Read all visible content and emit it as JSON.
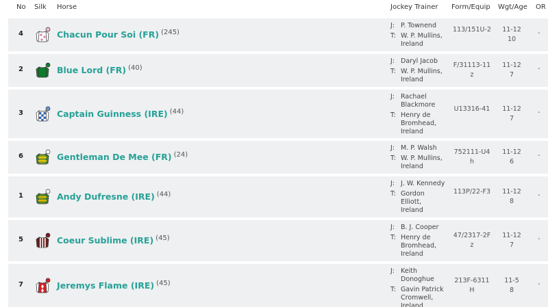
{
  "headers": {
    "no": "No",
    "silk": "Silk",
    "horse": "Horse",
    "jockey_trainer": "Jockey Trainer",
    "form": "Form/Equip",
    "wgt": "Wgt/Age",
    "or": "OR"
  },
  "runners": [
    {
      "no": "4",
      "horse": "Chacun Pour Soi (FR)",
      "rating": "(245)",
      "jockey_prefix": "J:",
      "jockey": [
        "P. Townend"
      ],
      "trainer_prefix": "T:",
      "trainer": [
        "W. P. Mullins,",
        "Ireland"
      ],
      "form": "113/151U-2",
      "equip": "",
      "wgt": "11-12",
      "age": "10",
      "or": "-",
      "silk": {
        "body": "#ffffff",
        "sleeves": "#ffffff",
        "pattern": "#d97aa6",
        "cap": "#f3b8cf"
      }
    },
    {
      "no": "2",
      "horse": "Blue Lord (FR)",
      "rating": "(40)",
      "jockey_prefix": "J:",
      "jockey": [
        "Daryl Jacob"
      ],
      "trainer_prefix": "T:",
      "trainer": [
        "W. P. Mullins,",
        "Ireland"
      ],
      "form": "F/31113-11",
      "equip": "z",
      "wgt": "11-12",
      "age": "7",
      "or": "-",
      "silk": {
        "body": "#0f7a2f",
        "sleeves": "#0f7a2f",
        "pattern": "#111111",
        "cap": "#0f7a2f"
      }
    },
    {
      "no": "3",
      "horse": "Captain Guinness (IRE)",
      "rating": "(44)",
      "jockey_prefix": "J:",
      "jockey": [
        "Rachael",
        "Blackmore"
      ],
      "trainer_prefix": "T:",
      "trainer": [
        "Henry de",
        "Bromhead,",
        "Ireland"
      ],
      "form": "U13316-41",
      "equip": "",
      "wgt": "11-12",
      "age": "7",
      "or": "-",
      "silk": {
        "body": "#ffffff",
        "sleeves": "#ffffff",
        "pattern": "#2f5fa8",
        "cap": "#6f93c9"
      }
    },
    {
      "no": "6",
      "horse": "Gentleman De Mee (FR)",
      "rating": "(24)",
      "jockey_prefix": "J:",
      "jockey": [
        "M. P. Walsh"
      ],
      "trainer_prefix": "T:",
      "trainer": [
        "W. P. Mullins,",
        "Ireland"
      ],
      "form": "752111-U4",
      "equip": "h",
      "wgt": "11-12",
      "age": "6",
      "or": "-",
      "silk": {
        "body": "#7a9a2a",
        "sleeves": "#2e8b2e",
        "pattern": "#e8c200",
        "cap": "#ffffff"
      }
    },
    {
      "no": "1",
      "horse": "Andy Dufresne (IRE)",
      "rating": "(44)",
      "jockey_prefix": "J:",
      "jockey": [
        "J. W. Kennedy"
      ],
      "trainer_prefix": "T:",
      "trainer": [
        "Gordon",
        "Elliott,",
        "Ireland"
      ],
      "form": "113P/22-F3",
      "equip": "",
      "wgt": "11-12",
      "age": "8",
      "or": "-",
      "silk": {
        "body": "#5f8f23",
        "sleeves": "#2e8b2e",
        "pattern": "#e0b100",
        "cap": "#ffffff"
      }
    },
    {
      "no": "5",
      "horse": "Coeur Sublime (IRE)",
      "rating": "(45)",
      "jockey_prefix": "J:",
      "jockey": [
        "B. J. Cooper"
      ],
      "trainer_prefix": "T:",
      "trainer": [
        "Henry de",
        "Bromhead,",
        "Ireland"
      ],
      "form": "47/2317-2F",
      "equip": "z",
      "wgt": "11-12",
      "age": "7",
      "or": "-",
      "silk": {
        "body": "#7a1a1a",
        "sleeves": "#7a1a1a",
        "pattern": "#ffffff",
        "cap": "#7a1a1a"
      }
    },
    {
      "no": "7",
      "horse": "Jeremys Flame (IRE)",
      "rating": "(45)",
      "jockey_prefix": "J:",
      "jockey": [
        "Keith",
        "Donoghue"
      ],
      "trainer_prefix": "T:",
      "trainer": [
        "Gavin Patrick",
        "Cromwell,",
        "Ireland"
      ],
      "form": "213F-6311",
      "equip": "H",
      "wgt": "11-5",
      "age": "8",
      "or": "-",
      "silk": {
        "body": "#d8202a",
        "sleeves": "#ffffff",
        "pattern": "#ffffff",
        "cap": "#d8202a"
      }
    }
  ]
}
